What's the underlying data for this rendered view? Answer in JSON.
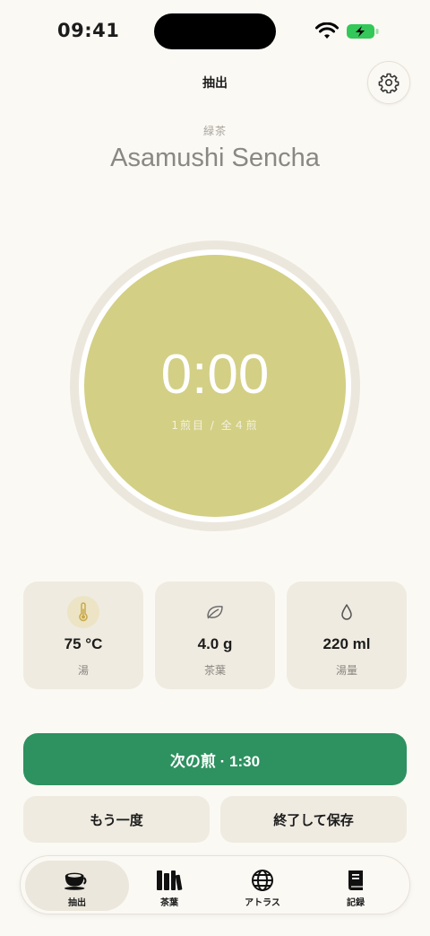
{
  "status": {
    "time": "09:41"
  },
  "header": {
    "title": "抽出"
  },
  "tea": {
    "category": "緑茶",
    "name": "Asamushi Sencha"
  },
  "timer": {
    "time": "0:00",
    "steep_info": "1煎目 / 全４煎"
  },
  "params": [
    {
      "value": "75 °C",
      "label": "湯",
      "icon": "thermometer-icon"
    },
    {
      "value": "4.0 g",
      "label": "茶葉",
      "icon": "leaf-icon"
    },
    {
      "value": "220 ml",
      "label": "湯量",
      "icon": "water-drop-icon"
    }
  ],
  "actions": {
    "primary": "次の煎 · 1:30",
    "repeat": "もう一度",
    "finish": "終了して保存"
  },
  "tabs": [
    {
      "label": "抽出",
      "icon": "teacup-icon",
      "active": true
    },
    {
      "label": "茶葉",
      "icon": "library-icon",
      "active": false
    },
    {
      "label": "アトラス",
      "icon": "globe-icon",
      "active": false
    },
    {
      "label": "記録",
      "icon": "book-icon",
      "active": false
    }
  ],
  "colors": {
    "background": "#fbf9f4",
    "timer_face": "#d3cf85",
    "primary": "#2e9160",
    "card": "#efebe1",
    "battery": "#34c759"
  }
}
